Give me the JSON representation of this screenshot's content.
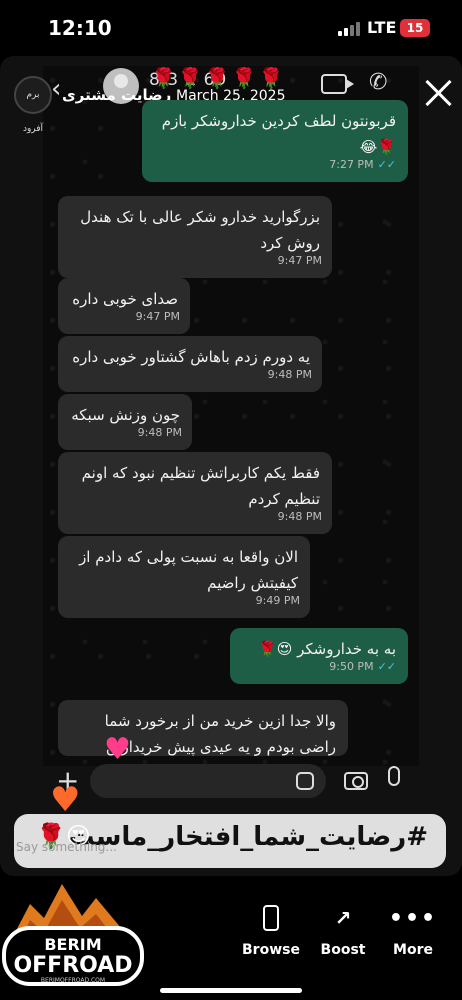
{
  "status_bar": {
    "time": "12:10",
    "network": "LTE",
    "battery": "15"
  },
  "story": {
    "author_name": "رضایت مشتری",
    "date": "March 25, 2025",
    "author_logo_text": "برم آفرود"
  },
  "chat": {
    "contact_number": "8  3  1  69",
    "contact_overlay": "🌹🌹🌹🌹🌹",
    "messages": [
      {
        "dir": "out",
        "text": "قربونتون لطف کردین خداروشکر بازم 🌹😂",
        "time": "7:27 PM",
        "ticks": "✓✓"
      },
      {
        "dir": "in",
        "text": "بزرگوارید خدارو شکر عالی با تک هندل روش کرد",
        "time": "9:47 PM"
      },
      {
        "dir": "in",
        "text": "صدای خوبی داره",
        "time": "9:47 PM"
      },
      {
        "dir": "in",
        "text": "یه دورم زدم باهاش گشتاور خوبی داره",
        "time": "9:48 PM"
      },
      {
        "dir": "in",
        "text": "چون وزنش سبکه",
        "time": "9:48 PM"
      },
      {
        "dir": "in",
        "text": "فقط یکم کاربراتش تنظیم نبود که اونم تنظیم کردم",
        "time": "9:48 PM"
      },
      {
        "dir": "in",
        "text": "الان واقعا به نسبت پولی که دادم از کیفیتش راضیم",
        "time": "9:49 PM"
      },
      {
        "dir": "out",
        "text": "به به خداروشکر 😍🌹",
        "time": "9:50 PM",
        "ticks": "✓✓"
      },
      {
        "dir": "in",
        "text": "والا جدا ازین خرید من از برخورد شما راضی بودم و یه عیدی پیش خریدارین",
        "time": ""
      }
    ]
  },
  "composer": {
    "placeholder": "Say something..."
  },
  "hashtag": {
    "text": "#رضایت_شما_افتخار_ماست",
    "emojis": "😍🌹"
  },
  "bottom_actions": [
    {
      "label": "Browse",
      "icon": "browse-icon"
    },
    {
      "label": "Boost",
      "icon": "boost-icon"
    },
    {
      "label": "More",
      "icon": "more-icon"
    }
  ],
  "brand": {
    "line1": "BERIM",
    "line2": "OFFROAD",
    "line3": "BERIMOFFROAD.COM"
  }
}
